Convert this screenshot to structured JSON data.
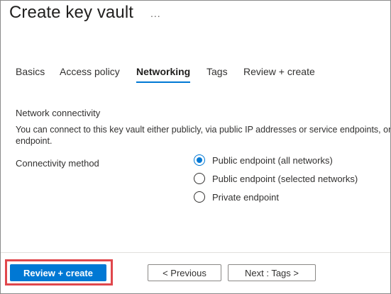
{
  "header": {
    "title": "Create key vault",
    "more_label": "..."
  },
  "tabs": [
    {
      "label": "Basics",
      "active": false
    },
    {
      "label": "Access policy",
      "active": false
    },
    {
      "label": "Networking",
      "active": true
    },
    {
      "label": "Tags",
      "active": false
    },
    {
      "label": "Review + create",
      "active": false
    }
  ],
  "network": {
    "section_title": "Network connectivity",
    "description_line1": "You can connect to this key vault either publicly, via public IP addresses or service endpoints, or privately, using a private",
    "description_line2": "endpoint.",
    "field_label": "Connectivity method",
    "options": [
      {
        "label": "Public endpoint (all networks)",
        "checked": true
      },
      {
        "label": "Public endpoint (selected networks)",
        "checked": false
      },
      {
        "label": "Private endpoint",
        "checked": false
      }
    ]
  },
  "footer": {
    "review_create_label": "Review + create",
    "previous_label": "< Previous",
    "next_label": "Next : Tags >"
  },
  "colors": {
    "accent": "#0078d4",
    "highlight": "#e0474c"
  }
}
